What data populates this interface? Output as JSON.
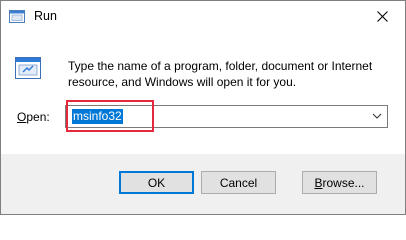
{
  "window": {
    "title": "Run",
    "close_symbol": "✕"
  },
  "description": {
    "line1": "Type the name of a program, folder, document or Internet",
    "line2": "resource, and Windows will open it for you."
  },
  "open": {
    "label_accel": "O",
    "label_rest": "pen:",
    "value": "msinfo32"
  },
  "buttons": {
    "ok": "OK",
    "cancel": "Cancel",
    "browse_accel": "B",
    "browse_rest": "rowse..."
  },
  "icons": {
    "app": "run-app-icon",
    "run": "run-dialog-icon",
    "dropdown": "chevron-down-icon",
    "close": "close-icon"
  },
  "colors": {
    "selection": "#0078d7",
    "highlight": "#e5283b",
    "footer": "#f0f0f0"
  }
}
